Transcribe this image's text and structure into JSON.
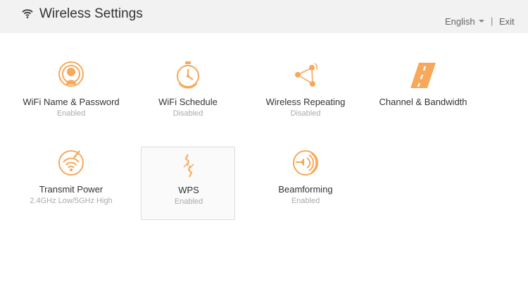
{
  "header": {
    "title": "Wireless Settings",
    "language": "English",
    "separator": "|",
    "exit": "Exit"
  },
  "accent_color": "#f7a85a",
  "tiles": [
    {
      "label": "WiFi Name & Password",
      "status": "Enabled",
      "icon": "wifi-user-icon"
    },
    {
      "label": "WiFi Schedule",
      "status": "Disabled",
      "icon": "stopwatch-icon"
    },
    {
      "label": "Wireless Repeating",
      "status": "Disabled",
      "icon": "repeater-icon"
    },
    {
      "label": "Channel & Bandwidth",
      "status": "",
      "icon": "road-icon"
    },
    {
      "label": "Transmit Power",
      "status": "2.4GHz Low/5GHz High",
      "icon": "signal-gauge-icon"
    },
    {
      "label": "WPS",
      "status": "Enabled",
      "icon": "wps-icon"
    },
    {
      "label": "Beamforming",
      "status": "Enabled",
      "icon": "beam-icon"
    }
  ]
}
